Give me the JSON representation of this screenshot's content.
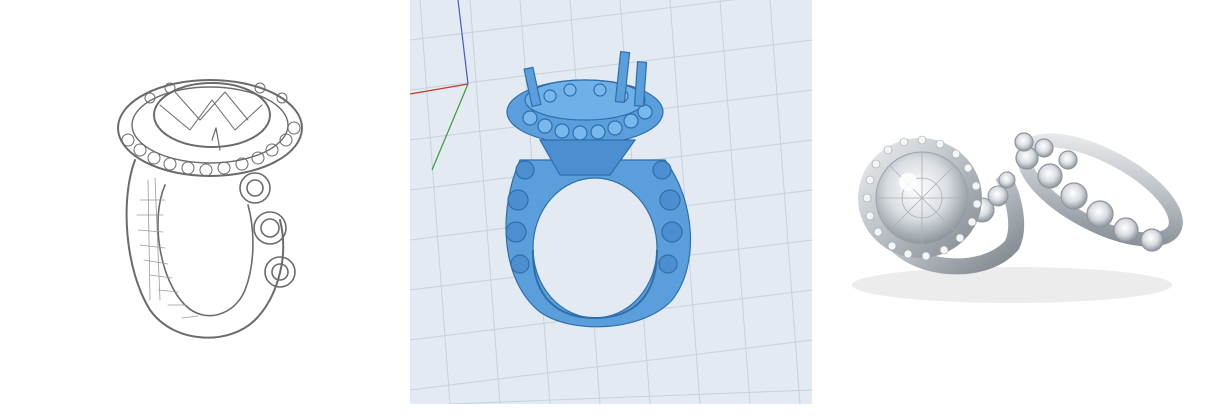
{
  "panels": [
    {
      "id": "sketch",
      "kind": "pencil-sketch-of-ring"
    },
    {
      "id": "cad",
      "kind": "3d-cad-model-of-ring"
    },
    {
      "id": "photo",
      "kind": "photo-of-finished-rings"
    }
  ],
  "colors": {
    "background": "#ffffff",
    "cad_background": "#e3eaf2",
    "cad_grid": "#c6d2df",
    "cad_model": "#5a9fdc",
    "cad_model_dark": "#2f6eaa",
    "axis_red": "#c0392b",
    "axis_green": "#3a9a3a",
    "axis_blue": "#4a5ac8",
    "sketch_stroke": "#6b6b6b",
    "metal": "#c9cdd2"
  }
}
